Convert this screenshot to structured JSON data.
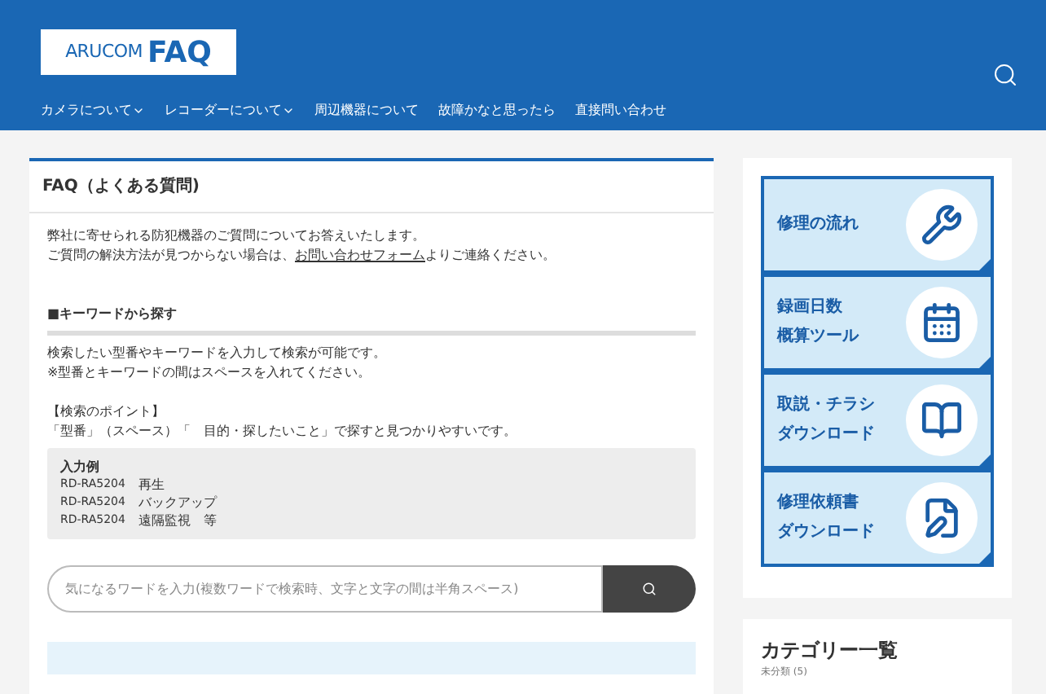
{
  "header": {
    "logo": {
      "brand": "ARUCOM",
      "faq": "FAQ"
    },
    "nav": [
      {
        "label": "カメラについて",
        "dropdown": true
      },
      {
        "label": "レコーダーについて",
        "dropdown": true
      },
      {
        "label": "周辺機器について",
        "dropdown": false
      },
      {
        "label": "故障かなと思ったら",
        "dropdown": false
      },
      {
        "label": "直接問い合わせ",
        "dropdown": false
      }
    ]
  },
  "main": {
    "title": "FAQ（よくある質問)",
    "intro": {
      "line1": "弊社に寄せられる防犯機器のご質問についてお答えいたします。",
      "line2_before": "ご質問の解決方法が見つからない場合は、",
      "link": "お問い合わせフォーム",
      "line2_after": "よりご連絡ください。"
    },
    "section_heading": "■キーワードから探す",
    "description": [
      "検索したい型番やキーワードを入力して検索が可能です。",
      "※型番とキーワードの間はスペースを入れてください。"
    ],
    "points_heading": "【検索のポイント】",
    "points_text": "「型番」（スペース）「　目的・探したいこと」で探すと見つかりやすいです。",
    "example": {
      "title": "入力例",
      "rows": [
        {
          "model": "RD-RA5204",
          "keyword": "再生"
        },
        {
          "model": "RD-RA5204",
          "keyword": "バックアップ"
        },
        {
          "model": "RD-RA5204",
          "keyword": "遠隔監視　等"
        }
      ]
    },
    "search": {
      "placeholder": "気になるワードを入力(複数ワードで検索時、文字と文字の間は半角スペース)"
    }
  },
  "sidebar": {
    "banners": [
      {
        "lines": [
          "修理の流れ"
        ]
      },
      {
        "lines": [
          "録画日数",
          "概算ツール"
        ]
      },
      {
        "lines": [
          "取説・チラシ",
          "ダウンロード"
        ]
      },
      {
        "lines": [
          "修理依頼書",
          "ダウンロード"
        ]
      }
    ],
    "categories": {
      "title": "カテゴリー一覧",
      "items": [
        "未分類 (5)"
      ]
    }
  }
}
